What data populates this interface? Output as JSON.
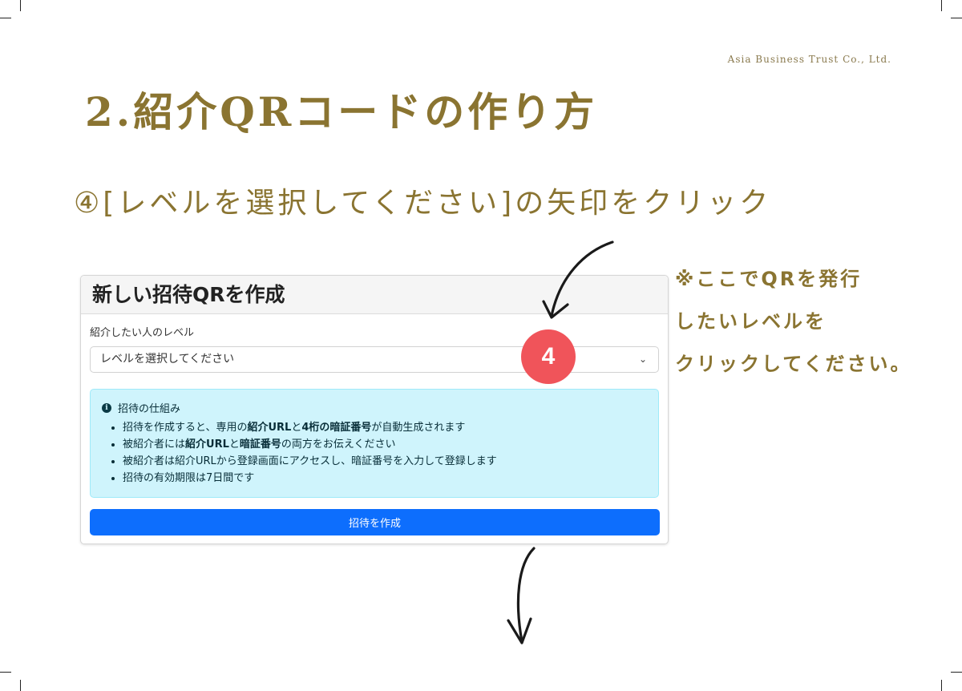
{
  "company": "Asia Business Trust Co., Ltd.",
  "page_title": "2.紹介QRコードの作り方",
  "step_instruction": "④[レベルを選択してください]の矢印をクリック",
  "note_lines": [
    "※ここでQRを発行",
    "したいレベルを",
    "クリックしてください。"
  ],
  "step_badge": "4",
  "card": {
    "title": "新しい招待QRを作成",
    "field_label": "紹介したい人のレベル",
    "select_value": "レベルを選択してください",
    "info_heading": "招待の仕組み",
    "info_items": [
      {
        "pre": "招待を作成すると、専用の",
        "b1": "紹介URL",
        "mid": "と",
        "b2": "4桁の暗証番号",
        "post": "が自動生成されます"
      },
      {
        "pre": "被紹介者には",
        "b1": "紹介URL",
        "mid": "と",
        "b2": "暗証番号",
        "post": "の両方をお伝えください"
      },
      {
        "text": "被紹介者は紹介URLから登録画面にアクセスし、暗証番号を入力して登録します"
      },
      {
        "text": "招待の有効期限は7日間です"
      }
    ],
    "submit_label": "招待を作成"
  },
  "icons": [
    "info-icon",
    "chevron-down-icon",
    "hand-drawn-arrow-icon"
  ],
  "colors": {
    "gold": "#8a7431",
    "primary": "#0d6efd",
    "info_bg": "#cff4fc",
    "badge": "#f0545a"
  }
}
